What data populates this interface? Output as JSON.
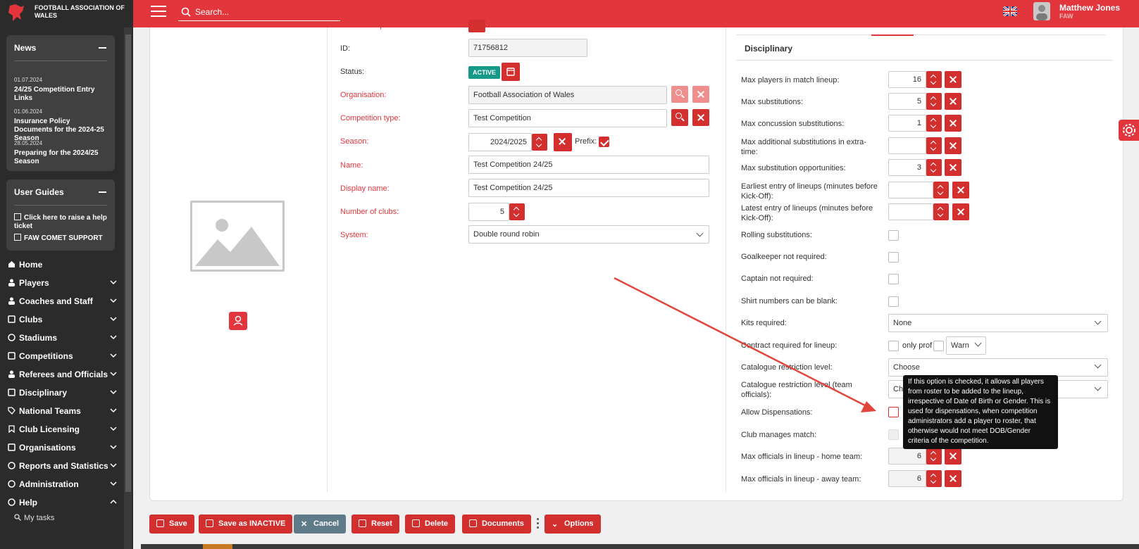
{
  "header": {
    "org_name": "FOOTBALL ASSOCIATION OF WALES",
    "search_placeholder": "Search...",
    "user_name": "Matthew Jones",
    "user_org": "FAW",
    "language_icon": "uk-flag-icon"
  },
  "sidebar": {
    "news": {
      "title": "News",
      "items": [
        {
          "date": "01.07.2024",
          "title": "24/25 Competition Entry Links"
        },
        {
          "date": "01.06.2024",
          "title": "Insurance Policy Documents for the 2024-25 Season"
        },
        {
          "date": "28.05.2024",
          "title": "Preparing for the 2024/25 Season"
        }
      ]
    },
    "guides": {
      "title": "User Guides",
      "links": [
        "Click here to raise a help ticket",
        "FAW COMET SUPPORT"
      ]
    },
    "nav": [
      {
        "label": "Home",
        "icon": "home-icon"
      },
      {
        "label": "Players",
        "icon": "players-icon"
      },
      {
        "label": "Coaches and Staff",
        "icon": "coaches-icon"
      },
      {
        "label": "Clubs",
        "icon": "clubs-icon"
      },
      {
        "label": "Stadiums",
        "icon": "stadium-icon"
      },
      {
        "label": "Competitions",
        "icon": "competitions-icon"
      },
      {
        "label": "Referees and Officials",
        "icon": "referees-icon"
      },
      {
        "label": "Disciplinary",
        "icon": "disciplinary-icon"
      },
      {
        "label": "National Teams",
        "icon": "tag-icon"
      },
      {
        "label": "Club Licensing",
        "icon": "bookmark-icon"
      },
      {
        "label": "Organisations",
        "icon": "organisations-icon"
      },
      {
        "label": "Reports and Statistics",
        "icon": "reports-icon"
      },
      {
        "label": "Administration",
        "icon": "admin-icon"
      },
      {
        "label": "Help",
        "icon": "help-icon"
      }
    ],
    "sub": {
      "my_tasks": "My tasks"
    }
  },
  "form": {
    "parent_competition_label": "Parent competition:",
    "id_label": "ID:",
    "id_value": "71756812",
    "status_label": "Status:",
    "status_value": "ACTIVE",
    "organisation_label": "Organisation:",
    "organisation_value": "Football Association of Wales",
    "competition_type_label": "Competition type:",
    "competition_type_value": "Test Competition",
    "season_label": "Season:",
    "season_value": "2024/2025",
    "prefix_label": "Prefix:",
    "name_label": "Name:",
    "name_value": "Test Competition 24/25",
    "display_name_label": "Display name:",
    "display_name_value": "Test Competition 24/25",
    "number_of_clubs_label": "Number of clubs:",
    "number_of_clubs_value": "5",
    "system_label": "System:",
    "system_value": "Double round robin"
  },
  "disciplinary": {
    "title": "Disciplinary",
    "max_players_label": "Max players in match lineup:",
    "max_players_value": "16",
    "max_subs_label": "Max substitutions:",
    "max_subs_value": "5",
    "max_concussion_label": "Max concussion substitutions:",
    "max_concussion_value": "1",
    "max_additional_label": "Max additional substitutions in extra-time:",
    "max_additional_value": "",
    "max_sub_opps_label": "Max substitution opportunities:",
    "max_sub_opps_value": "3",
    "earliest_entry_label": "Earliest entry of lineups (minutes before Kick-Off):",
    "latest_entry_label": "Latest entry of lineups (minutes before Kick-Off):",
    "rolling_label": "Rolling substitutions:",
    "gk_label": "Goalkeeper not required:",
    "captain_label": "Captain not required:",
    "shirt_label": "Shirt numbers can be blank:",
    "kits_label": "Kits required:",
    "kits_value": "None",
    "contract_label": "Contract required for lineup:",
    "only_prof_label": "only prof",
    "warn_value": "Warn",
    "catalogue_label": "Catalogue restriction level:",
    "catalogue_value": "Choose",
    "catalogue_team_label": "Catalogue restriction level (team officials):",
    "catalogue_team_value": "Ch",
    "allow_disp_label": "Allow Dispensations:",
    "club_manages_label": "Club manages match:",
    "max_officials_home_label": "Max officials in lineup - home team:",
    "max_officials_home_value": "6",
    "max_officials_away_label": "Max officials in lineup - away team:",
    "max_officials_away_value": "6"
  },
  "tooltip": "If this option is checked, it allows all players from roster to be added to the lineup, irrespective of Date of Birth or Gender. This is used for dispensations, when competition administrators add a player to roster, that otherwise would not meet DOB/Gender criteria of the competition.",
  "actions": {
    "save": "Save",
    "save_inactive": "Save as INACTIVE",
    "cancel": "Cancel",
    "reset": "Reset",
    "delete": "Delete",
    "documents": "Documents",
    "options": "Options"
  },
  "colors": {
    "brand_red": "#e2363c",
    "active_badge": "#159a8a",
    "sidebar_bg": "#2b2b2b"
  }
}
